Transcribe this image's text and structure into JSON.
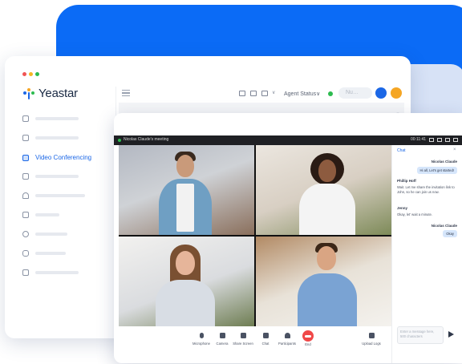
{
  "window": {
    "dot_colors": [
      "#f05454",
      "#f5b624",
      "#2dbb4f"
    ]
  },
  "brand": {
    "name": "Yeastar"
  },
  "sidebar": {
    "items": [
      {
        "icon": "contacts-icon",
        "label": "",
        "active": false
      },
      {
        "icon": "document-icon",
        "label": "",
        "active": false
      },
      {
        "icon": "video-conferencing-icon",
        "label": "Video Conferencing",
        "active": true
      },
      {
        "icon": "monitor-icon",
        "label": "",
        "active": false
      },
      {
        "icon": "headset-icon",
        "label": "",
        "active": false
      },
      {
        "icon": "file-icon",
        "label": "",
        "active": false
      },
      {
        "icon": "voicemail-icon",
        "label": "",
        "active": false
      },
      {
        "icon": "microphone-icon",
        "label": "",
        "active": false
      },
      {
        "icon": "list-settings-icon",
        "label": "",
        "active": false
      }
    ]
  },
  "topbar": {
    "agent_status": "Agent Status∨",
    "search_placeholder": "Nu…",
    "status_color": "#2dbb4f",
    "accent": "#1b67e6"
  },
  "meeting": {
    "title": "Nicolas Claude's meeting",
    "timer": "00:11:41"
  },
  "chat": {
    "title": "Chat",
    "messages": [
      {
        "sender": "Nicolas Claude",
        "text": "Hi all, Let's get started!",
        "side": "right"
      },
      {
        "sender": "Phillip Hoff",
        "text": "Wait. Let me share the invitation link to John, so he can join us now.",
        "side": "left"
      },
      {
        "sender": "Jenny",
        "text": "Okay, let' wait a minute.",
        "side": "left"
      },
      {
        "sender": "Nicolas Claude",
        "text": "Okay",
        "side": "right"
      }
    ],
    "input_placeholder": "Enter a message here, 500 characters"
  },
  "toolbar": {
    "microphone": "Microphone",
    "camera": "Camera",
    "share_screen": "Share Screen",
    "chat": "Chat",
    "participants": "Participants",
    "end": "End",
    "upload_logs": "Upload Logs"
  }
}
